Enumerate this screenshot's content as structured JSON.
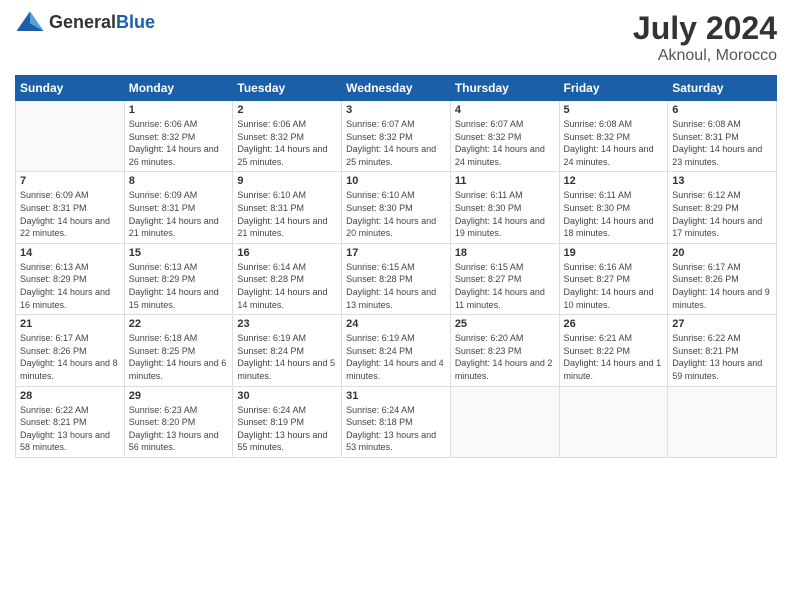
{
  "header": {
    "logo_general": "General",
    "logo_blue": "Blue",
    "month_year": "July 2024",
    "location": "Aknoul, Morocco"
  },
  "days_of_week": [
    "Sunday",
    "Monday",
    "Tuesday",
    "Wednesday",
    "Thursday",
    "Friday",
    "Saturday"
  ],
  "weeks": [
    [
      {
        "day": "",
        "empty": true
      },
      {
        "day": "1",
        "sunrise": "Sunrise: 6:06 AM",
        "sunset": "Sunset: 8:32 PM",
        "daylight": "Daylight: 14 hours and 26 minutes."
      },
      {
        "day": "2",
        "sunrise": "Sunrise: 6:06 AM",
        "sunset": "Sunset: 8:32 PM",
        "daylight": "Daylight: 14 hours and 25 minutes."
      },
      {
        "day": "3",
        "sunrise": "Sunrise: 6:07 AM",
        "sunset": "Sunset: 8:32 PM",
        "daylight": "Daylight: 14 hours and 25 minutes."
      },
      {
        "day": "4",
        "sunrise": "Sunrise: 6:07 AM",
        "sunset": "Sunset: 8:32 PM",
        "daylight": "Daylight: 14 hours and 24 minutes."
      },
      {
        "day": "5",
        "sunrise": "Sunrise: 6:08 AM",
        "sunset": "Sunset: 8:32 PM",
        "daylight": "Daylight: 14 hours and 24 minutes."
      },
      {
        "day": "6",
        "sunrise": "Sunrise: 6:08 AM",
        "sunset": "Sunset: 8:31 PM",
        "daylight": "Daylight: 14 hours and 23 minutes."
      }
    ],
    [
      {
        "day": "7",
        "sunrise": "Sunrise: 6:09 AM",
        "sunset": "Sunset: 8:31 PM",
        "daylight": "Daylight: 14 hours and 22 minutes."
      },
      {
        "day": "8",
        "sunrise": "Sunrise: 6:09 AM",
        "sunset": "Sunset: 8:31 PM",
        "daylight": "Daylight: 14 hours and 21 minutes."
      },
      {
        "day": "9",
        "sunrise": "Sunrise: 6:10 AM",
        "sunset": "Sunset: 8:31 PM",
        "daylight": "Daylight: 14 hours and 21 minutes."
      },
      {
        "day": "10",
        "sunrise": "Sunrise: 6:10 AM",
        "sunset": "Sunset: 8:30 PM",
        "daylight": "Daylight: 14 hours and 20 minutes."
      },
      {
        "day": "11",
        "sunrise": "Sunrise: 6:11 AM",
        "sunset": "Sunset: 8:30 PM",
        "daylight": "Daylight: 14 hours and 19 minutes."
      },
      {
        "day": "12",
        "sunrise": "Sunrise: 6:11 AM",
        "sunset": "Sunset: 8:30 PM",
        "daylight": "Daylight: 14 hours and 18 minutes."
      },
      {
        "day": "13",
        "sunrise": "Sunrise: 6:12 AM",
        "sunset": "Sunset: 8:29 PM",
        "daylight": "Daylight: 14 hours and 17 minutes."
      }
    ],
    [
      {
        "day": "14",
        "sunrise": "Sunrise: 6:13 AM",
        "sunset": "Sunset: 8:29 PM",
        "daylight": "Daylight: 14 hours and 16 minutes."
      },
      {
        "day": "15",
        "sunrise": "Sunrise: 6:13 AM",
        "sunset": "Sunset: 8:29 PM",
        "daylight": "Daylight: 14 hours and 15 minutes."
      },
      {
        "day": "16",
        "sunrise": "Sunrise: 6:14 AM",
        "sunset": "Sunset: 8:28 PM",
        "daylight": "Daylight: 14 hours and 14 minutes."
      },
      {
        "day": "17",
        "sunrise": "Sunrise: 6:15 AM",
        "sunset": "Sunset: 8:28 PM",
        "daylight": "Daylight: 14 hours and 13 minutes."
      },
      {
        "day": "18",
        "sunrise": "Sunrise: 6:15 AM",
        "sunset": "Sunset: 8:27 PM",
        "daylight": "Daylight: 14 hours and 11 minutes."
      },
      {
        "day": "19",
        "sunrise": "Sunrise: 6:16 AM",
        "sunset": "Sunset: 8:27 PM",
        "daylight": "Daylight: 14 hours and 10 minutes."
      },
      {
        "day": "20",
        "sunrise": "Sunrise: 6:17 AM",
        "sunset": "Sunset: 8:26 PM",
        "daylight": "Daylight: 14 hours and 9 minutes."
      }
    ],
    [
      {
        "day": "21",
        "sunrise": "Sunrise: 6:17 AM",
        "sunset": "Sunset: 8:26 PM",
        "daylight": "Daylight: 14 hours and 8 minutes."
      },
      {
        "day": "22",
        "sunrise": "Sunrise: 6:18 AM",
        "sunset": "Sunset: 8:25 PM",
        "daylight": "Daylight: 14 hours and 6 minutes."
      },
      {
        "day": "23",
        "sunrise": "Sunrise: 6:19 AM",
        "sunset": "Sunset: 8:24 PM",
        "daylight": "Daylight: 14 hours and 5 minutes."
      },
      {
        "day": "24",
        "sunrise": "Sunrise: 6:19 AM",
        "sunset": "Sunset: 8:24 PM",
        "daylight": "Daylight: 14 hours and 4 minutes."
      },
      {
        "day": "25",
        "sunrise": "Sunrise: 6:20 AM",
        "sunset": "Sunset: 8:23 PM",
        "daylight": "Daylight: 14 hours and 2 minutes."
      },
      {
        "day": "26",
        "sunrise": "Sunrise: 6:21 AM",
        "sunset": "Sunset: 8:22 PM",
        "daylight": "Daylight: 14 hours and 1 minute."
      },
      {
        "day": "27",
        "sunrise": "Sunrise: 6:22 AM",
        "sunset": "Sunset: 8:21 PM",
        "daylight": "Daylight: 13 hours and 59 minutes."
      }
    ],
    [
      {
        "day": "28",
        "sunrise": "Sunrise: 6:22 AM",
        "sunset": "Sunset: 8:21 PM",
        "daylight": "Daylight: 13 hours and 58 minutes."
      },
      {
        "day": "29",
        "sunrise": "Sunrise: 6:23 AM",
        "sunset": "Sunset: 8:20 PM",
        "daylight": "Daylight: 13 hours and 56 minutes."
      },
      {
        "day": "30",
        "sunrise": "Sunrise: 6:24 AM",
        "sunset": "Sunset: 8:19 PM",
        "daylight": "Daylight: 13 hours and 55 minutes."
      },
      {
        "day": "31",
        "sunrise": "Sunrise: 6:24 AM",
        "sunset": "Sunset: 8:18 PM",
        "daylight": "Daylight: 13 hours and 53 minutes."
      },
      {
        "day": "",
        "empty": true
      },
      {
        "day": "",
        "empty": true
      },
      {
        "day": "",
        "empty": true
      }
    ]
  ]
}
